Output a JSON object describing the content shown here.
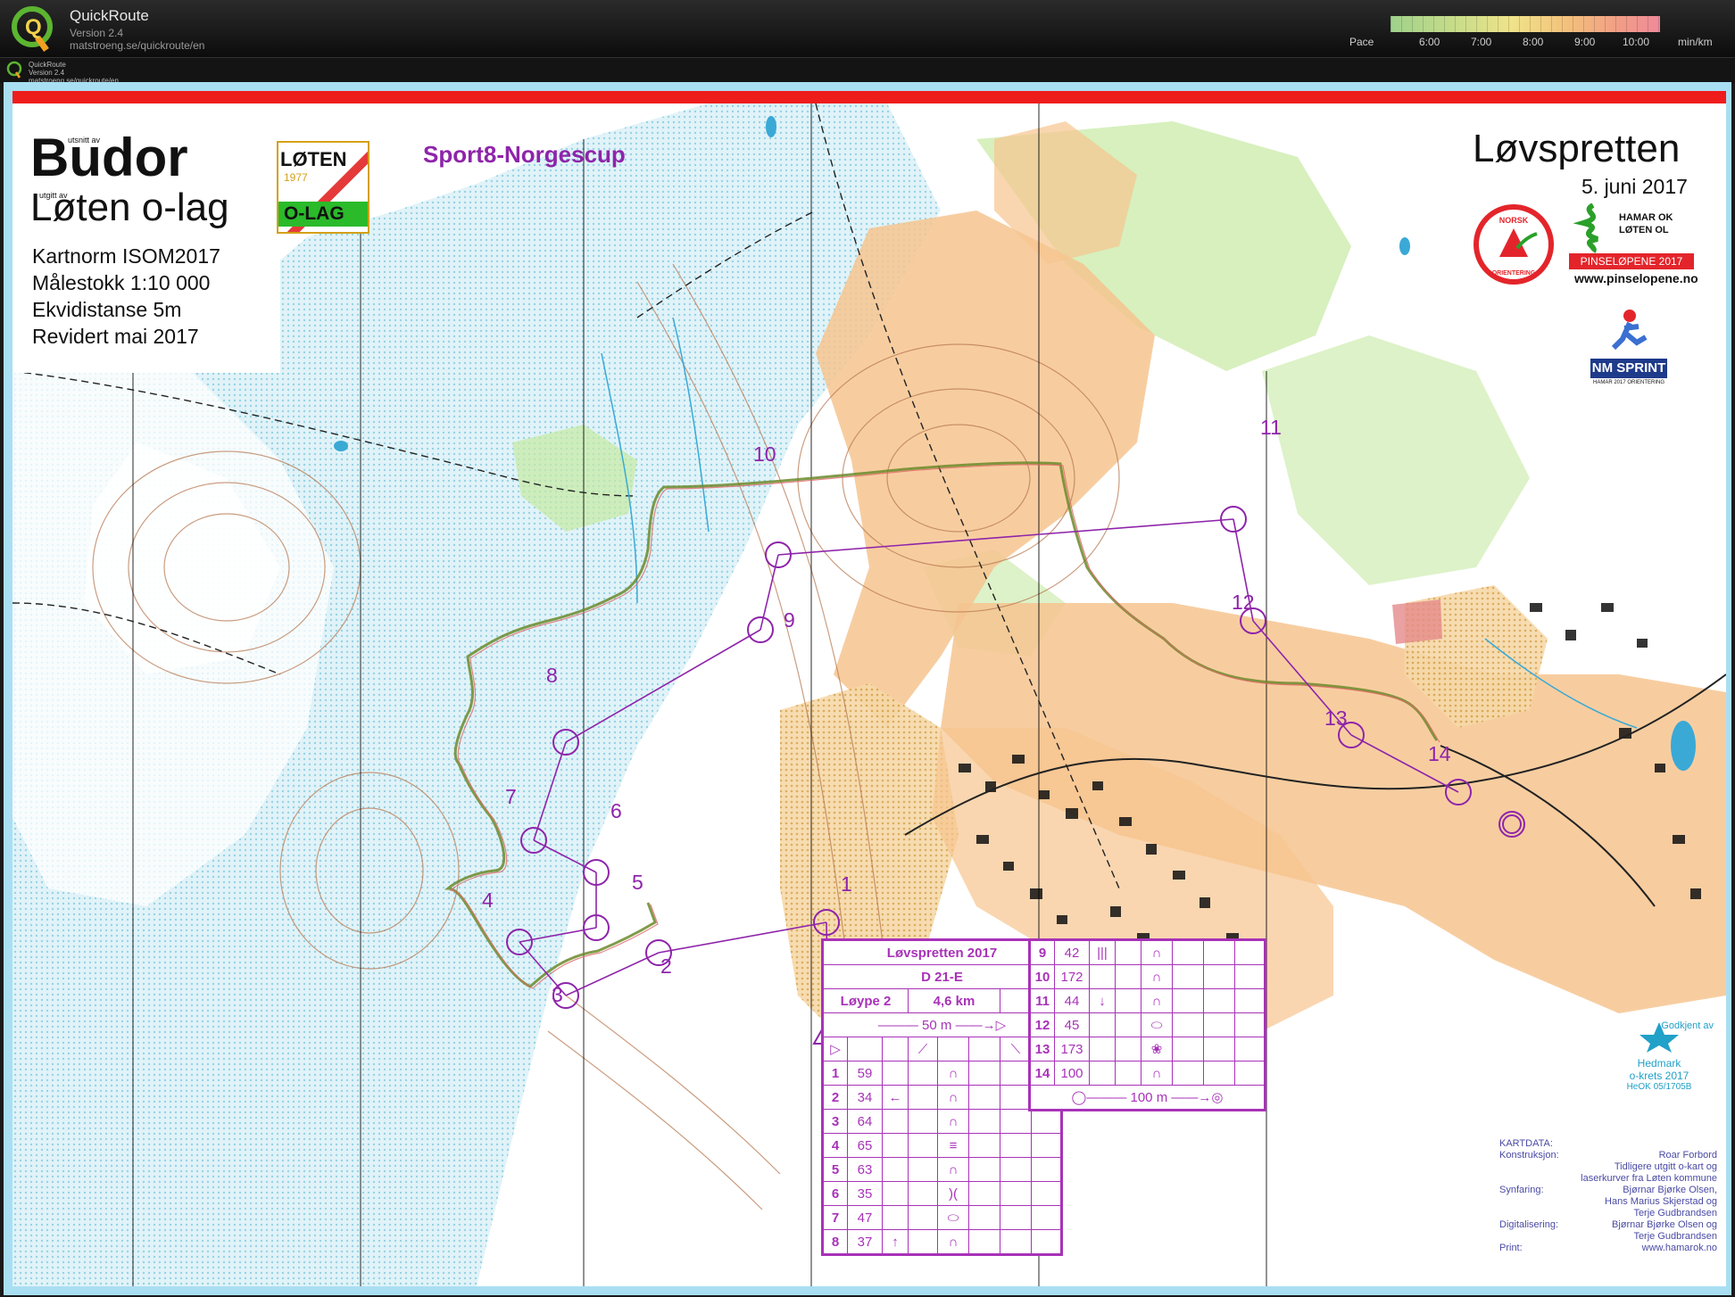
{
  "app": {
    "name": "QuickRoute",
    "version": "Version 2.4",
    "url": "matstroeng.se/quickroute/en",
    "sub_name": "QuickRoute",
    "sub_version": "Version 2.4",
    "sub_url": "matstroeng.se/quickroute/en"
  },
  "pace_legend": {
    "label": "Pace",
    "ticks": [
      "6:00",
      "7:00",
      "8:00",
      "9:00",
      "10:00"
    ],
    "unit": "min/km"
  },
  "map": {
    "area_prefix": "utsnitt av",
    "area_name": "Budor",
    "publisher_prefix": "utgitt av",
    "publisher": "Løten o-lag",
    "specs": [
      "Kartnorm ISOM2017",
      "Målestokk 1:10 000",
      "Ekvidistanse 5m",
      "Revidert mai 2017"
    ],
    "club_logo": {
      "line1": "LØTEN",
      "year": "1977",
      "line2": "O-LAG"
    },
    "cup": "Sport8-Norgescup",
    "event_title": "Løvspretten",
    "event_date": "5. juni 2017",
    "norsk_logo_top": "NORSK",
    "norsk_logo_bottom": "ORIENTERING",
    "hamar_logo": {
      "line1": "HAMAR OK",
      "line2": "LØTEN OL",
      "banner": "PINSELØPENE 2017"
    },
    "pinse_web": "www.pinselopene.no",
    "nm_logo": {
      "nm": "NM",
      "sprint": "SPRINT",
      "sub": "HAMAR 2017   ORIENTERING"
    },
    "hedmark": {
      "line1": "Godkjent av",
      "line2": "Hedmark",
      "line3": "o-krets 2017",
      "line4": "HeOK 05/1705B"
    }
  },
  "controls": [
    {
      "label": "1"
    },
    {
      "label": "2"
    },
    {
      "label": "3"
    },
    {
      "label": "4"
    },
    {
      "label": "5"
    },
    {
      "label": "6"
    },
    {
      "label": "7"
    },
    {
      "label": "8"
    },
    {
      "label": "9"
    },
    {
      "label": "10"
    },
    {
      "label": "11"
    },
    {
      "label": "12"
    },
    {
      "label": "13"
    },
    {
      "label": "14"
    }
  ],
  "description_sheet": {
    "title": "Løvspretten 2017",
    "class": "D 21-E",
    "course": "Løype 2",
    "length": "4,6 km",
    "start_note": "50 m",
    "finish_note": "100 m",
    "rows_left": [
      {
        "n": "1",
        "code": "59",
        "dir": "",
        "sym": "∩"
      },
      {
        "n": "2",
        "code": "34",
        "dir": "←",
        "sym": "∩"
      },
      {
        "n": "3",
        "code": "64",
        "dir": "",
        "sym": "∩"
      },
      {
        "n": "4",
        "code": "65",
        "dir": "",
        "sym": "≡"
      },
      {
        "n": "5",
        "code": "63",
        "dir": "",
        "sym": "∩"
      },
      {
        "n": "6",
        "code": "35",
        "dir": "",
        "sym": ")("
      },
      {
        "n": "7",
        "code": "47",
        "dir": "",
        "sym": "⬭"
      },
      {
        "n": "8",
        "code": "37",
        "dir": "↑",
        "sym": "∩"
      }
    ],
    "rows_right": [
      {
        "n": "9",
        "code": "42",
        "dir": "|||",
        "sym": "∩"
      },
      {
        "n": "10",
        "code": "172",
        "dir": "",
        "sym": "∩"
      },
      {
        "n": "11",
        "code": "44",
        "dir": "↓",
        "sym": "∩"
      },
      {
        "n": "12",
        "code": "45",
        "dir": "",
        "sym": "⬭"
      },
      {
        "n": "13",
        "code": "173",
        "dir": "",
        "sym": "❀"
      },
      {
        "n": "14",
        "code": "100",
        "dir": "",
        "sym": "∩"
      }
    ]
  },
  "kartdata": {
    "heading": "KARTDATA:",
    "lines": [
      [
        "Konstruksjon:",
        "Roar Forbord"
      ],
      [
        "",
        "Tidligere utgitt o-kart og"
      ],
      [
        "",
        "laserkurver fra Løten kommune"
      ],
      [
        "Synfaring:",
        "Bjørnar Bjørke Olsen,"
      ],
      [
        "",
        "Hans Marius Skjerstad og"
      ],
      [
        "",
        "Terje Gudbrandsen"
      ],
      [
        "Digitalisering:",
        "Bjørnar Bjørke Olsen og"
      ],
      [
        "",
        "Terje Gudbrandsen"
      ],
      [
        "Print:",
        "www.hamarok.no"
      ]
    ]
  },
  "colors": {
    "course": "#8e24aa",
    "forest_white": "#ffffff",
    "green_light": "#c6eaa3",
    "open_land": "#f6c48f",
    "water": "#3aa9d6",
    "route": "#5a7a2a",
    "redbar": "#ef1c1c"
  }
}
